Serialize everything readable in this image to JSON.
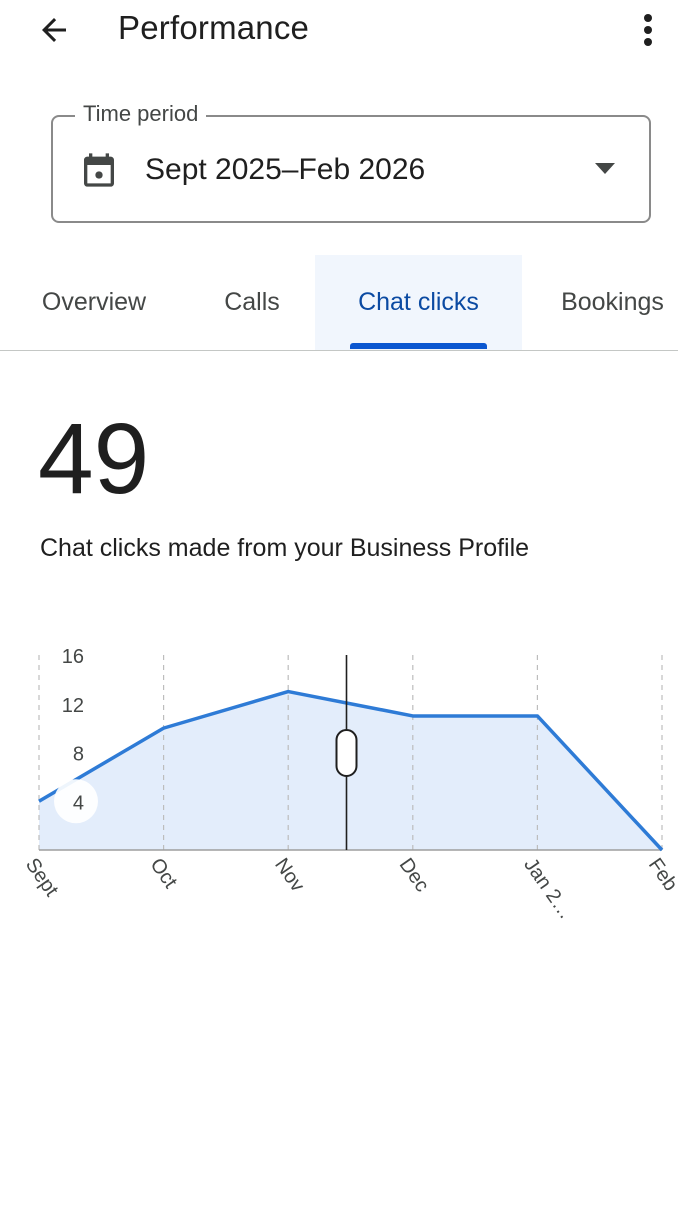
{
  "appbar": {
    "title": "Performance",
    "back_icon": "arrow-back-icon",
    "more_icon": "more-vert-icon"
  },
  "time_period": {
    "label": "Time period",
    "value": "Sept 2025–Feb 2026",
    "icon": "calendar-icon"
  },
  "tabs": [
    {
      "label": "Overview",
      "active": false
    },
    {
      "label": "Calls",
      "active": false
    },
    {
      "label": "Chat clicks",
      "active": true
    },
    {
      "label": "Bookings",
      "active": false
    }
  ],
  "metric": {
    "value": "49",
    "description": "Chat clicks made from your Business Profile"
  },
  "colors": {
    "accent": "#0b57d0",
    "active_tab_text": "#0b4aa2",
    "active_tab_bg": "#f1f6fd",
    "line": "#2e7bd6",
    "area": "#e3edfb"
  },
  "chart_data": {
    "type": "area",
    "categories": [
      "Sept",
      "Oct",
      "Nov",
      "Dec",
      "Jan 2…",
      "Feb"
    ],
    "values": [
      4,
      10,
      13,
      11,
      11,
      0
    ],
    "y_ticks": [
      4,
      8,
      12,
      16
    ],
    "ylim": [
      0,
      16
    ],
    "grid": "vertical-dashed",
    "selected_marker": "between Nov and Dec"
  }
}
